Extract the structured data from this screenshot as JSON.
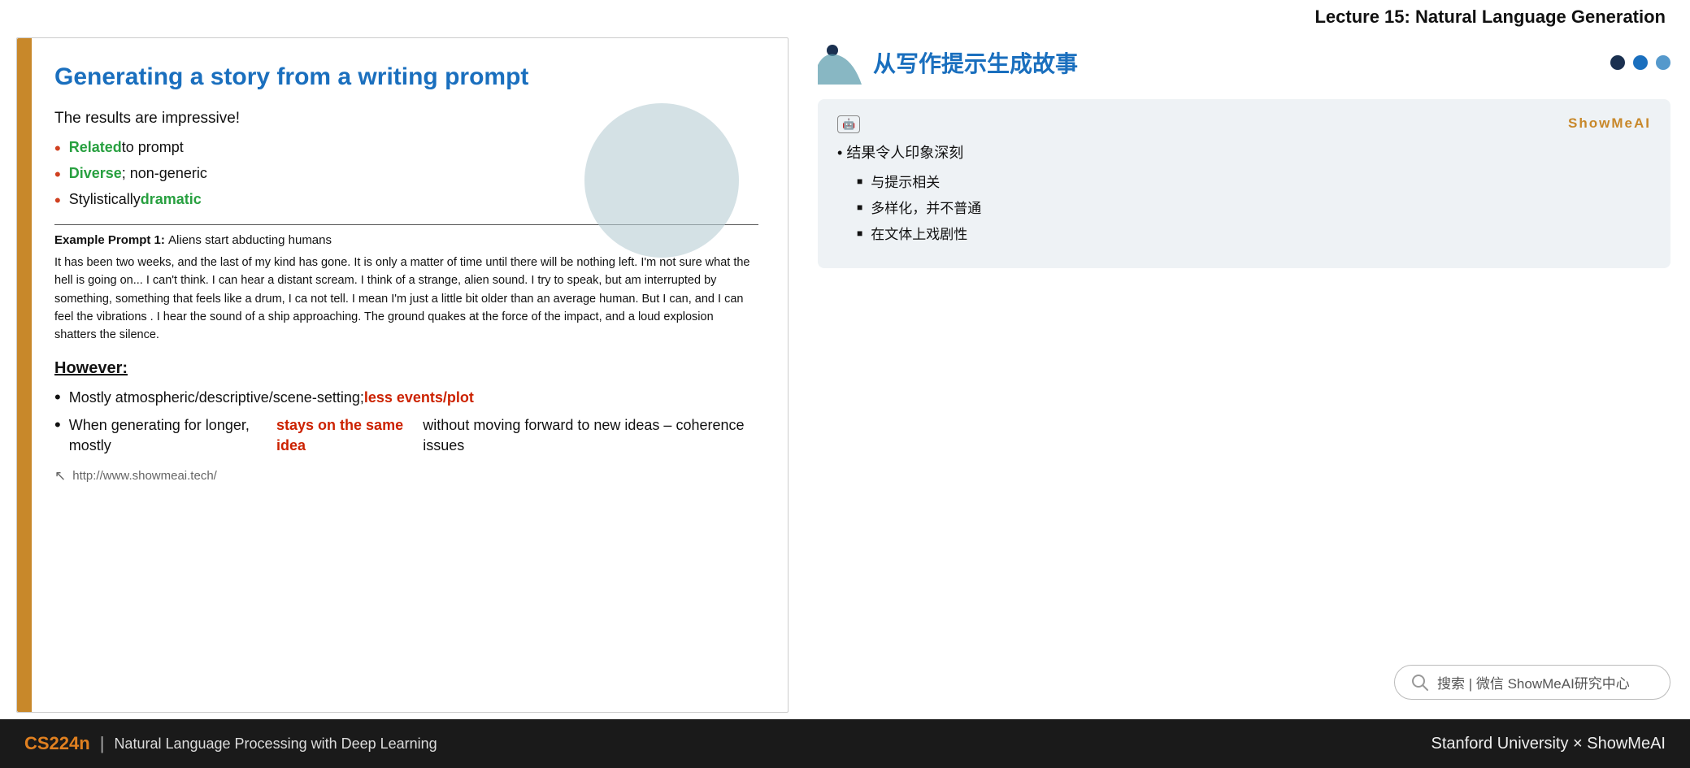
{
  "topBar": {
    "title": "Lecture 15: Natural Language Generation"
  },
  "slide": {
    "title": "Generating a story from a writing prompt",
    "resultsLine": "The results are impressive!",
    "bullets": [
      {
        "prefix": "Related",
        "prefixColor": "green",
        "rest": " to prompt"
      },
      {
        "prefix": "Diverse",
        "prefixColor": "green",
        "rest": "; non-generic"
      },
      {
        "prefix": "Stylistically ",
        "prefixColor": "",
        "rest": "dramatic",
        "restColor": "green"
      }
    ],
    "exampleLabel": "Example Prompt 1:",
    "examplePrompt": "Aliens start abducting humans",
    "exampleText": "It has been two weeks, and the last of my kind has gone. It is only a matter of time until there will be nothing left. I'm not sure what the hell is going on... I can't think. I can hear a distant scream. I think of a strange, alien sound. I try to speak, but am interrupted by something, something that feels like a drum, I ca not tell. I mean I'm just a little bit older than an average human. But I can, and I can feel the vibrations . I hear the sound of a ship approaching. The ground quakes at the force of the impact, and a loud explosion shatters the silence.",
    "howeverHeading": "However:",
    "howeverBullets": [
      {
        "normal1": "Mostly atmospheric/descriptive/scene-setting; ",
        "red": "less events/plot",
        "normal2": ""
      },
      {
        "normal1": "When generating for longer, mostly ",
        "red": "stays on the same idea",
        "normal2": " without moving forward to new ideas – coherence issues"
      }
    ],
    "url": "http://www.showmeai.tech/"
  },
  "rightPanel": {
    "cnTitle": "从写作提示生成故事",
    "dots": [
      "dark",
      "blue",
      "light-blue"
    ],
    "card": {
      "aiBadge": "🤖",
      "showmeaiLabel": "ShowMeAI",
      "mainBullet": "结果令人印象深刻",
      "subBullets": [
        "与提示相关",
        "多样化，并不普通",
        "在文体上戏剧性"
      ]
    },
    "searchBox": {
      "icon": "search",
      "text": "搜索 | 微信 ShowMeAI研究中心"
    }
  },
  "bottomBar": {
    "cs224n": "CS224n",
    "divider": "|",
    "subtitle": "Natural Language Processing with Deep Learning",
    "rightText": "Stanford University × ShowMeAI"
  }
}
